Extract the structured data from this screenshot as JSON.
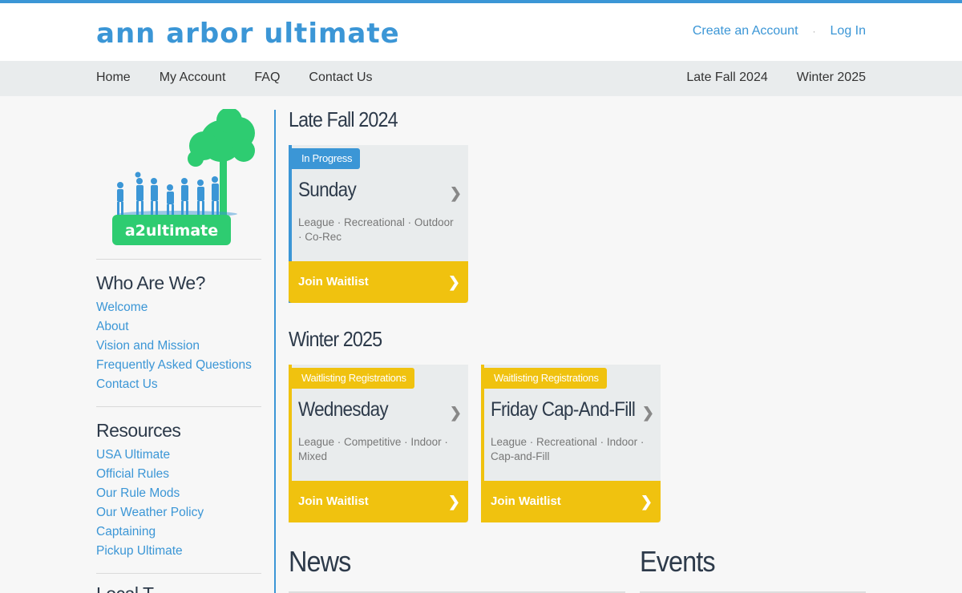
{
  "header": {
    "brand": "ann arbor ultimate",
    "create_account": "Create an Account",
    "separator": "·",
    "login": "Log In"
  },
  "nav": {
    "left": [
      "Home",
      "My Account",
      "FAQ",
      "Contact Us"
    ],
    "right": [
      "Late Fall 2024",
      "Winter 2025"
    ]
  },
  "logo": {
    "text": "a2ultimate"
  },
  "sidebar": {
    "who": {
      "title": "Who Are We?",
      "links": [
        "Welcome",
        "About",
        "Vision and Mission",
        "Frequently Asked Questions",
        "Contact Us"
      ]
    },
    "resources": {
      "title": "Resources",
      "links": [
        "USA Ultimate",
        "Official Rules",
        "Our Rule Mods",
        "Our Weather Policy",
        "Captaining",
        "Pickup Ultimate"
      ]
    },
    "cut_title": "Local T..."
  },
  "seasons": [
    {
      "title": "Late Fall 2024",
      "cards": [
        {
          "badge": "In Progress",
          "name": "Sunday",
          "tags": "League · Recreational · Outdoor · Co-Rec",
          "button": "Join Waitlist"
        }
      ]
    },
    {
      "title": "Winter 2025",
      "cards": [
        {
          "badge": "Waitlisting Registrations",
          "name": "Wednesday",
          "tags": "League · Competitive · Indoor · Mixed",
          "button": "Join Waitlist"
        },
        {
          "badge": "Waitlisting Registrations",
          "name": "Friday Cap-And-Fill",
          "tags": "League · Recreational · Indoor · Cap-and-Fill",
          "button": "Join Waitlist"
        }
      ]
    }
  ],
  "news": {
    "title": "News"
  },
  "events": {
    "title": "Events"
  },
  "colors": {
    "accent": "#3b96d6",
    "yellow": "#f0c20f",
    "nav_bg": "#e9eced",
    "logo_green": "#2ecc71"
  },
  "icons": {
    "chevron": "chevron-right-icon"
  }
}
